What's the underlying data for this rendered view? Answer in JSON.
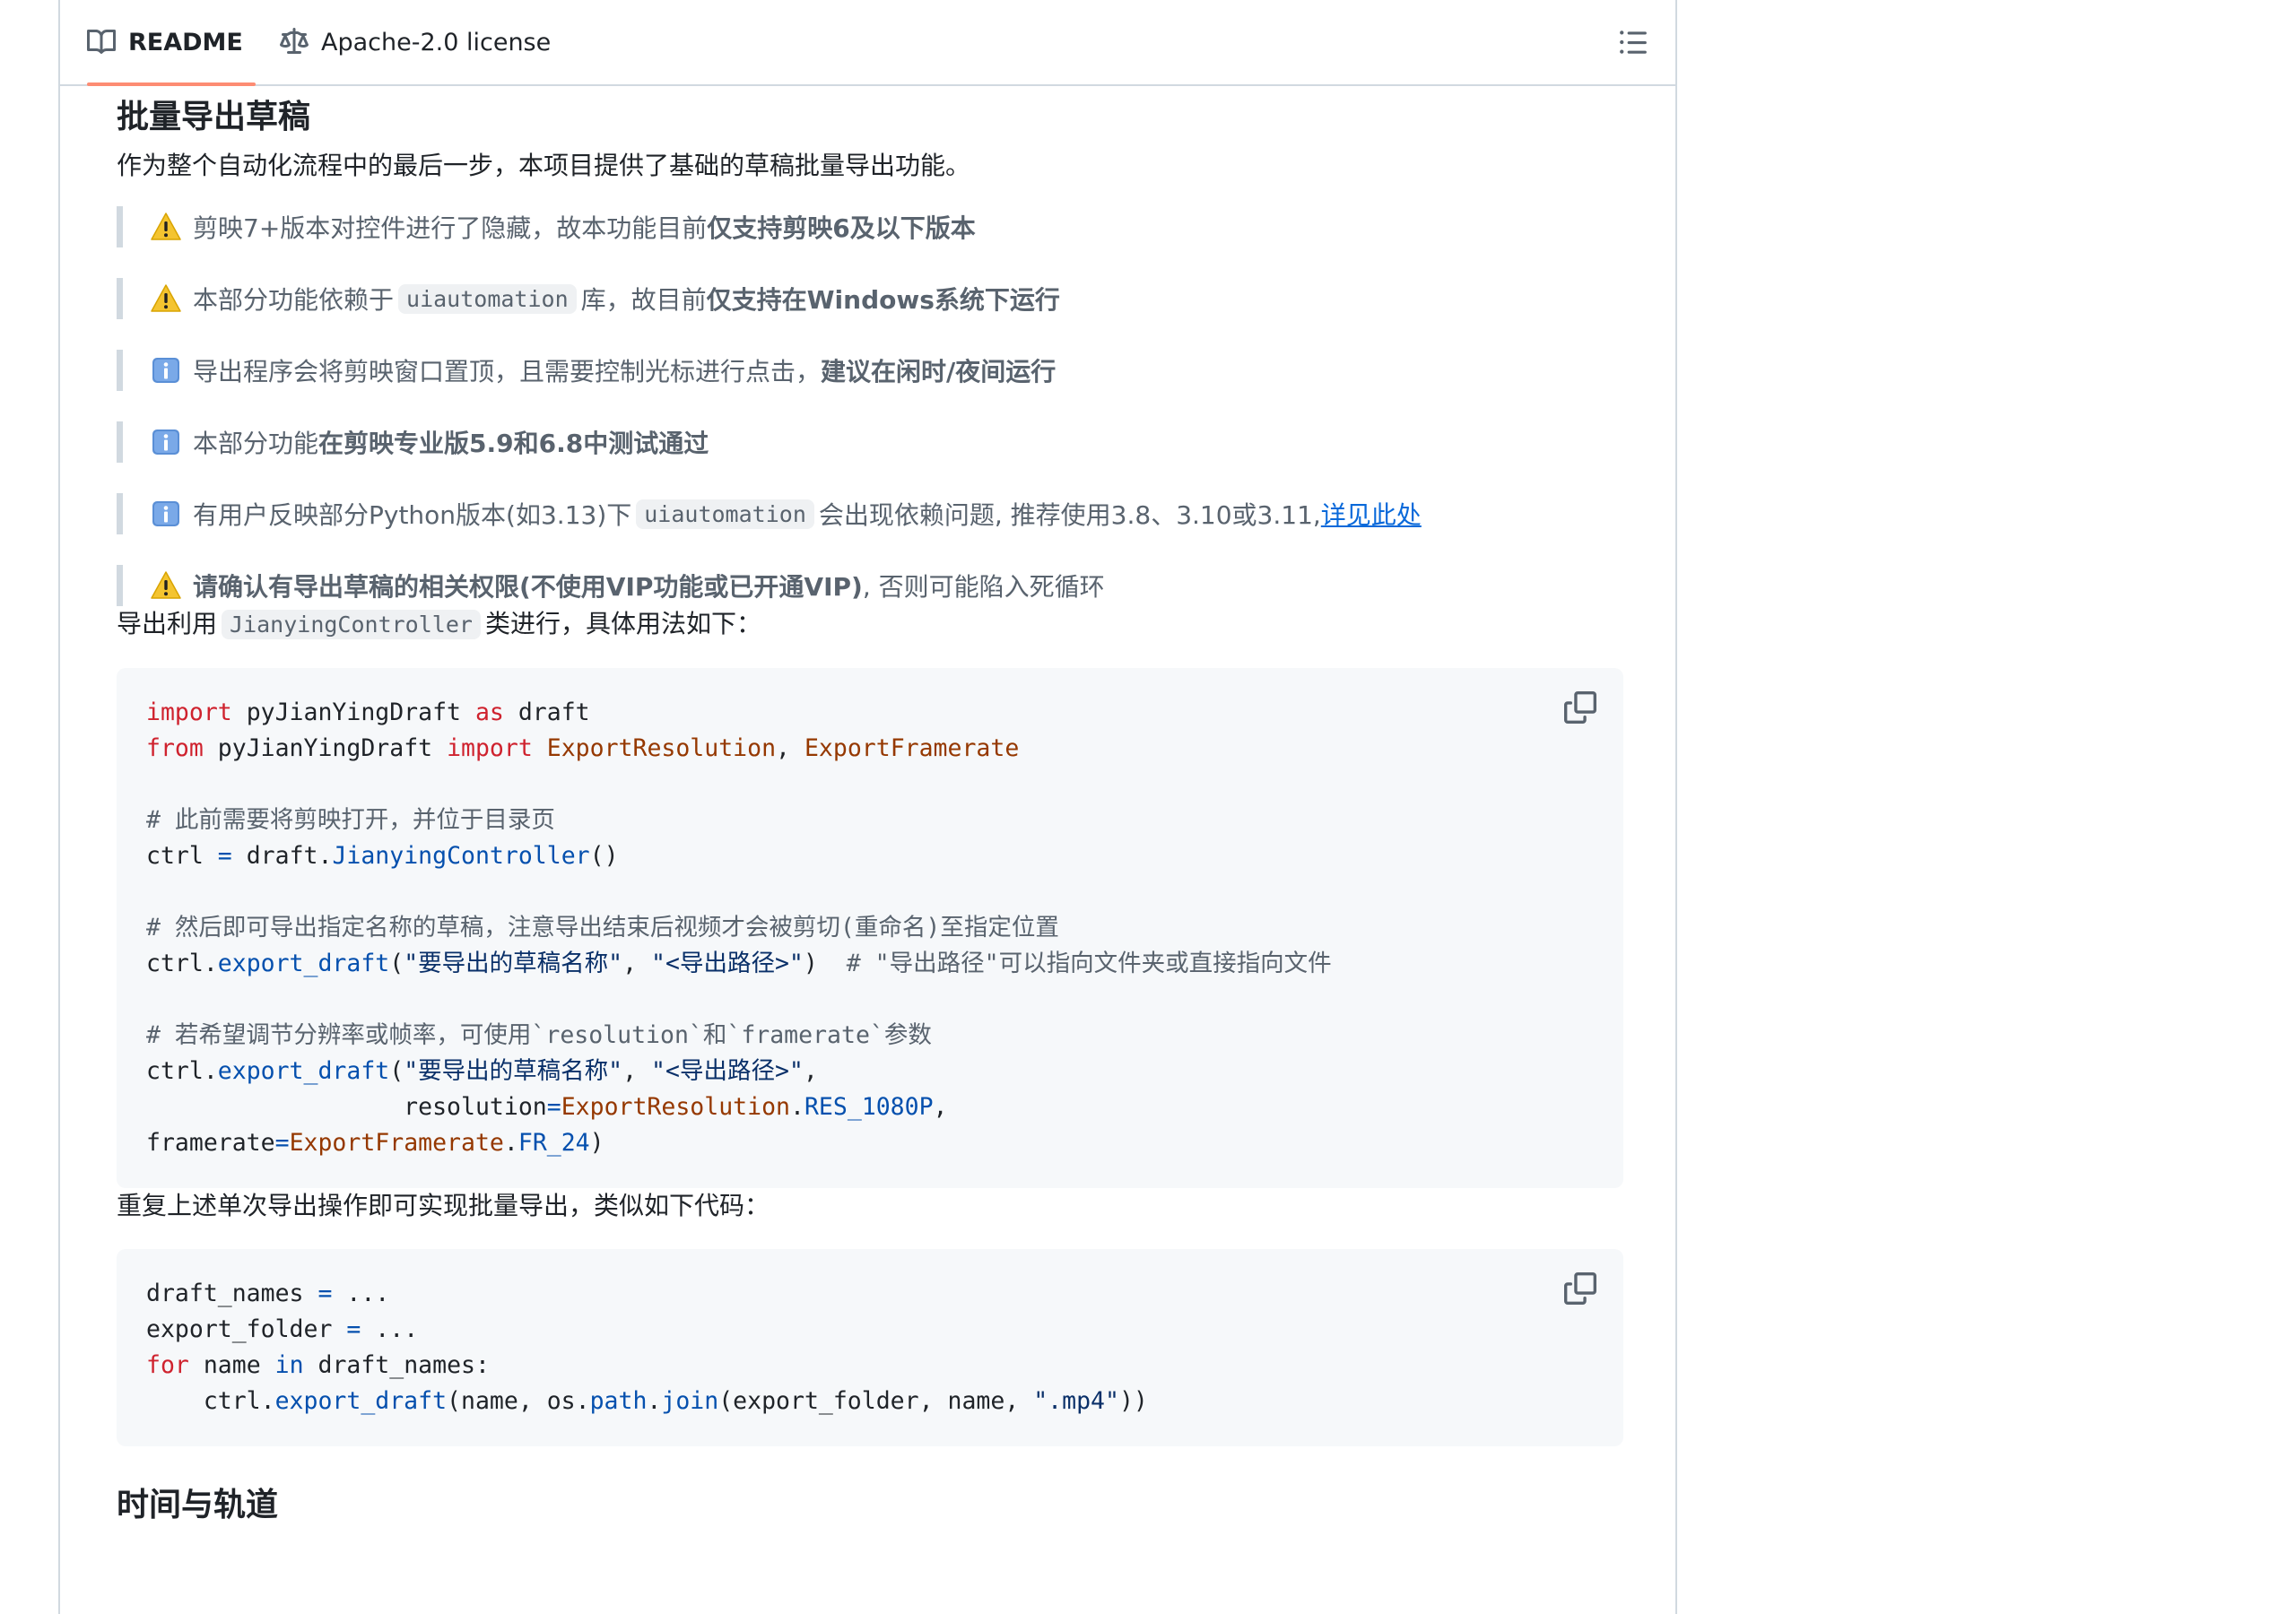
{
  "tabs": {
    "readme_label": "README",
    "license_label": "Apache-2.0 license"
  },
  "section": {
    "title": "批量导出草稿",
    "intro": "作为整个自动化流程中的最后一步，本项目提供了基础的草稿批量导出功能。"
  },
  "notes": [
    {
      "icon": "warning-icon",
      "text": "剪映7+版本对控件进行了隐藏，故本功能目前",
      "bold": "仅支持剪映6及以下版本"
    },
    {
      "icon": "warning-icon",
      "pre": "本部分功能依赖于",
      "code": "uiautomation",
      "post": "库，故目前",
      "bold": "仅支持在Windows系统下运行"
    },
    {
      "icon": "info-icon",
      "text": "导出程序会将剪映窗口置顶，且需要控制光标进行点击，",
      "bold": "建议在闲时/夜间运行"
    },
    {
      "icon": "info-icon",
      "text": "本部分功能",
      "bold": "在剪映专业版5.9和6.8中测试通过"
    },
    {
      "icon": "info-icon",
      "pre": "有用户反映部分Python版本(如3.13)下",
      "code": "uiautomation",
      "post": "会出现依赖问题, 推荐使用3.8、3.10或3.11, ",
      "link": "详见此处"
    },
    {
      "icon": "warning-icon",
      "bold": "请确认有导出草稿的相关权限(不使用VIP功能或已开通VIP)",
      "text": ", 否则可能陷入死循环"
    }
  ],
  "usage": {
    "pre": "导出利用",
    "code": "JianyingController",
    "post": "类进行，具体用法如下："
  },
  "code1": {
    "l1_kw1": "import",
    "l1_mod": " pyJianYingDraft ",
    "l1_kw2": "as",
    "l1_alias": " draft",
    "l2_kw1": "from",
    "l2_mod": " pyJianYingDraft ",
    "l2_kw2": "import",
    "l2_cls1": "ExportResolution",
    "l2_comma": ", ",
    "l2_cls2": "ExportFramerate",
    "c1": "# 此前需要将剪映打开，并位于目录页",
    "l4_var": "ctrl ",
    "l4_op": "=",
    "l4_mod": " draft.",
    "l4_fn": "JianyingController",
    "l4_end": "()",
    "c2": "# 然后即可导出指定名称的草稿，注意导出结束后视频才会被剪切(重命名)至指定位置",
    "l6_var": "ctrl.",
    "l6_fn": "export_draft",
    "l6_open": "(",
    "l6_s1": "\"要导出的草稿名称\"",
    "l6_comma": ", ",
    "l6_s2": "\"<导出路径>\"",
    "l6_close": ")  ",
    "l6_cm": "# \"导出路径\"可以指向文件夹或直接指向文件",
    "c3": "# 若希望调节分辨率或帧率，可使用`resolution`和`framerate`参数",
    "l8_var": "ctrl.",
    "l8_fn": "export_draft",
    "l8_open": "(",
    "l8_s1": "\"要导出的草稿名称\"",
    "l8_comma": ", ",
    "l8_s2": "\"<导出路径>\"",
    "l8_end": ",",
    "l9_indent": "                  resolution",
    "l9_op": "=",
    "l9_cls": "ExportResolution",
    "l9_dot": ".",
    "l9_const": "RES_1080P",
    "l9_end": ",",
    "l10_var": "framerate",
    "l10_op": "=",
    "l10_cls": "ExportFramerate",
    "l10_dot": ".",
    "l10_const": "FR_24",
    "l10_end": ")"
  },
  "repeat_text": "重复上述单次导出操作即可实现批量导出，类似如下代码：",
  "code2": {
    "l1_var": "draft_names ",
    "l1_op": "=",
    "l1_end": " ...",
    "l2_var": "export_folder ",
    "l2_op": "=",
    "l2_end": " ...",
    "l3_kw1": "for",
    "l3_mid": " name ",
    "l3_kw2": "in",
    "l3_end": " draft_names:",
    "l4_indent": "    ctrl.",
    "l4_fn": "export_draft",
    "l4_mid": "(name, os.",
    "l4_fn2": "path",
    "l4_dot": ".",
    "l4_fn3": "join",
    "l4_args": "(export_folder, name, ",
    "l4_str": "\".mp4\"",
    "l4_end": "))"
  },
  "next_heading": "时间与轨道"
}
